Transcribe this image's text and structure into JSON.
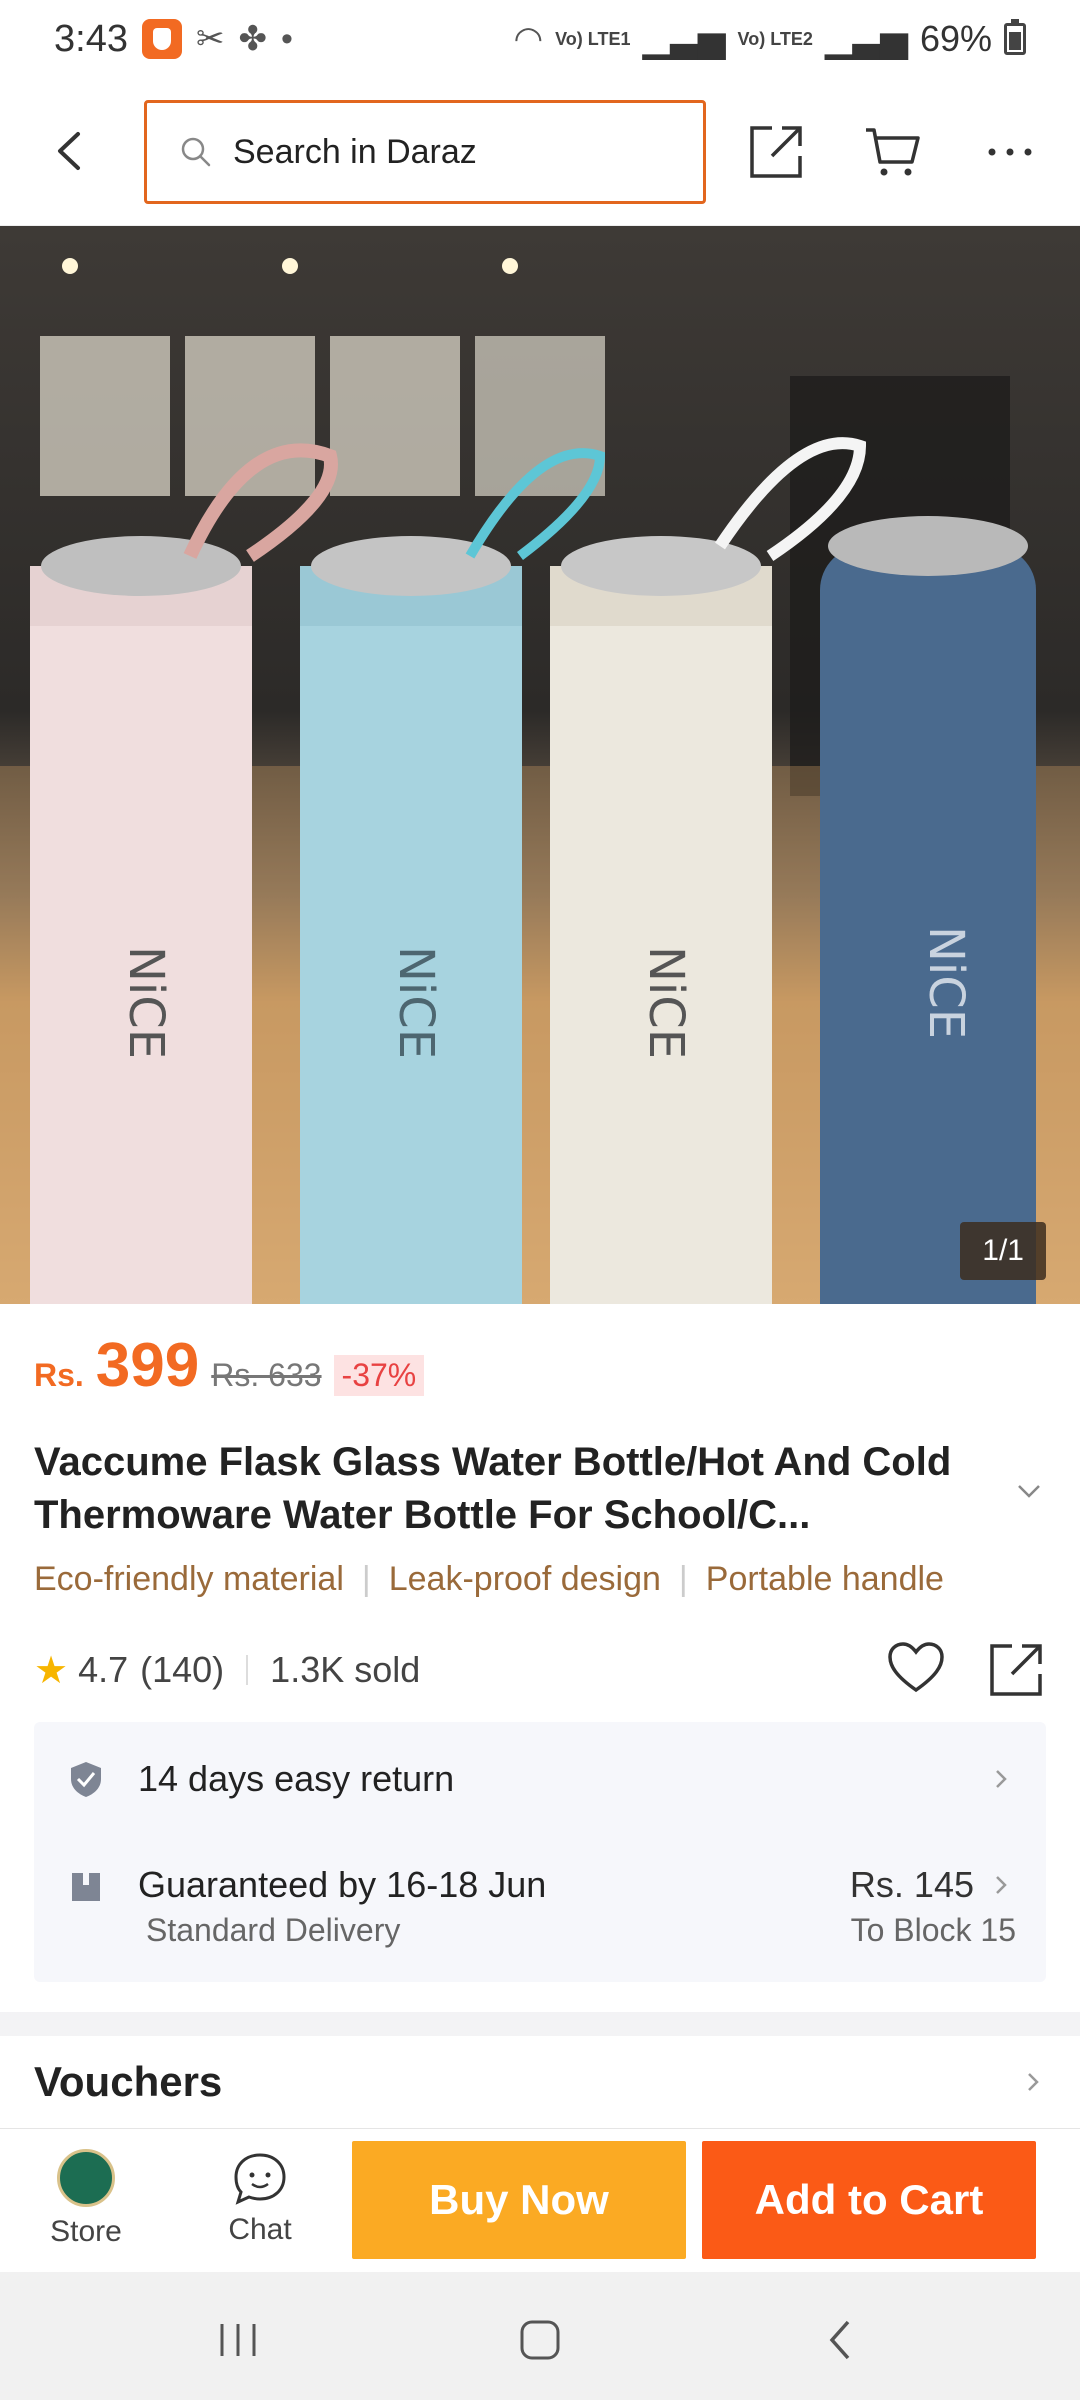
{
  "status_bar": {
    "time": "3:43",
    "battery": "69%",
    "sim1": "Vo) LTE1",
    "sim2": "Vo) LTE2"
  },
  "header": {
    "search_placeholder": "Search in Daraz",
    "icons": [
      "back-arrow-icon",
      "search-icon",
      "share-icon",
      "cart-icon",
      "more-icon"
    ],
    "accent_color": "#e2661e"
  },
  "gallery": {
    "counter": "1/1",
    "product_brand_print": "NiCE",
    "bottle_colors": [
      "#f0dede",
      "#a7d3df",
      "#ece8de",
      "#4a6a8e"
    ]
  },
  "price": {
    "currency": "Rs.",
    "current": "399",
    "original": "Rs. 633",
    "discount": "-37%",
    "color": "#f26a22"
  },
  "product": {
    "title": "Vaccume Flask Glass Water Bottle/Hot And Cold Thermoware Water Bottle For School/C...",
    "tags": [
      "Eco-friendly material",
      "Leak-proof design",
      "Portable handle"
    ]
  },
  "rating": {
    "score": "4.7",
    "count": "(140)",
    "sold": "1.3K sold"
  },
  "services": {
    "return_text": "14 days easy return",
    "delivery_text": "Guaranteed by 16-18 Jun",
    "delivery_type": "Standard Delivery",
    "delivery_price": "Rs. 145",
    "delivery_to": "To Block 15"
  },
  "vouchers": {
    "title": "Vouchers"
  },
  "bottom_bar": {
    "store_label": "Store",
    "chat_label": "Chat",
    "buy_now_label": "Buy Now",
    "add_to_cart_label": "Add to Cart",
    "buy_color": "#fbaa23",
    "cart_color": "#fb5a16"
  }
}
